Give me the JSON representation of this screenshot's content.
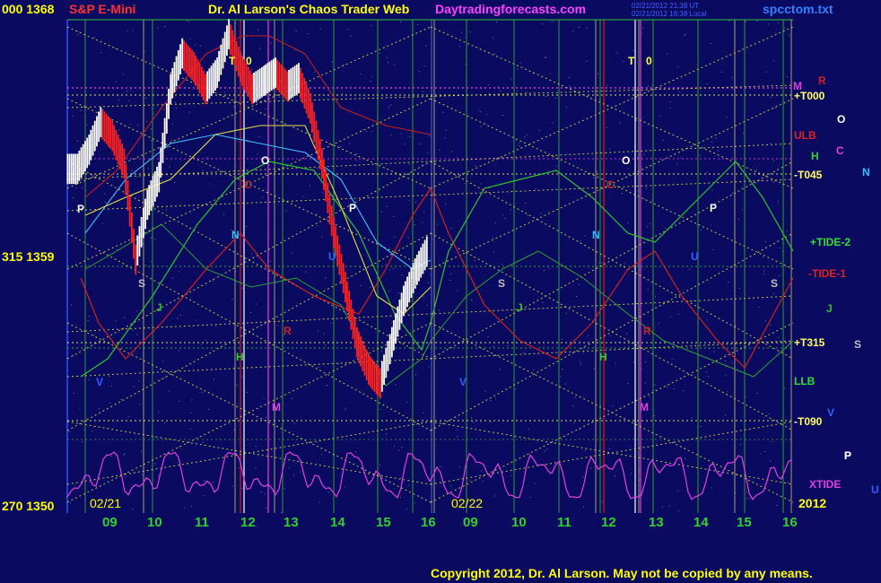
{
  "header": {
    "price_top": "000  1368",
    "instrument": "S&P E-Mini",
    "title": "Dr. Al Larson's Chaos Trader Web",
    "site": "Daytradingforecasts.com",
    "timestamp1": "02/21/2012 21:38 UT",
    "timestamp2": "02/21/2012 16:38 Local",
    "file": "spcctom.txt"
  },
  "left_axis": {
    "mid": "315  1359",
    "bottom": "270  1350"
  },
  "date_labels": [
    "02/21",
    "02/22"
  ],
  "year": "2012",
  "copyright": "Copyright 2012, Dr. Al Larson. May not be copied by any means.",
  "colors": {
    "background": "#0a0a60",
    "grid_green": "#2f9a2f",
    "grid_yellow": "#e8e84a",
    "price_bar_up": "#ffffff",
    "price_bar_down": "#ff2020",
    "xtide": "#e040e0",
    "tide_green": "#30c030",
    "tide_red": "#d02020",
    "cyan_avg": "#40c0ff",
    "yellow_avg": "#e0e040"
  },
  "chart_data": {
    "type": "line",
    "title": "S&P E-Mini",
    "y_axis_left": [
      {
        "value": 1368,
        "label": "000  1368"
      },
      {
        "value": 1359,
        "label": "315  1359"
      },
      {
        "value": 1350,
        "label": "270  1350"
      }
    ],
    "ylim": [
      1350,
      1368
    ],
    "x_tick_labels": [
      "09",
      "10",
      "11",
      "12",
      "13",
      "14",
      "15",
      "16",
      "09",
      "10",
      "11",
      "12",
      "13",
      "14",
      "15",
      "16"
    ],
    "sessions": [
      "02/21",
      "02/22"
    ],
    "price_close_series": {
      "name": "S&P E-Mini",
      "hours": [
        8.5,
        8.75,
        9.0,
        9.25,
        9.5,
        9.75,
        10.0,
        10.25,
        10.5,
        10.75,
        11.0,
        11.25,
        11.5,
        11.75,
        12.0,
        12.25,
        12.5,
        12.75,
        13.0,
        13.25,
        13.5,
        13.75,
        14.0,
        14.25,
        14.5,
        14.75,
        15.0,
        15.25,
        15.5,
        15.75,
        16.0
      ],
      "closes": [
        1362.3,
        1363.0,
        1364.0,
        1363.5,
        1362.5,
        1359.0,
        1361.0,
        1362.0,
        1365.2,
        1366.5,
        1366.0,
        1365.2,
        1365.8,
        1367.2,
        1366.0,
        1365.2,
        1365.5,
        1365.8,
        1365.3,
        1365.6,
        1364.5,
        1362.5,
        1360.0,
        1358.0,
        1356.0,
        1355.0,
        1354.5,
        1356.0,
        1357.5,
        1358.5,
        1359.3
      ]
    },
    "right_labels": [
      {
        "text": "M",
        "color": "#e040e0"
      },
      {
        "text": "R",
        "color": "#d02020"
      },
      {
        "text": "+T000",
        "color": "#ffff60"
      },
      {
        "text": "O",
        "color": "#ffffff"
      },
      {
        "text": "ULB",
        "color": "#e02020"
      },
      {
        "text": "C",
        "color": "#e040e0"
      },
      {
        "text": "H",
        "color": "#30d030"
      },
      {
        "text": "-T045",
        "color": "#ffff60"
      },
      {
        "text": "N",
        "color": "#30c0ff"
      },
      {
        "text": "P",
        "color": "#ffffff"
      },
      {
        "text": "+TIDE-2",
        "color": "#30e030"
      },
      {
        "text": "-TIDE-1",
        "color": "#e02020"
      },
      {
        "text": "J",
        "color": "#30c030"
      },
      {
        "text": "+T315",
        "color": "#ffff60"
      },
      {
        "text": "S",
        "color": "#c0c0c0"
      },
      {
        "text": "LLB",
        "color": "#30e030"
      },
      {
        "text": "V",
        "color": "#3060ff"
      },
      {
        "text": "-T090",
        "color": "#ffff60"
      },
      {
        "text": "P",
        "color": "#ffffff"
      },
      {
        "text": "XTIDE",
        "color": "#e040e0"
      },
      {
        "text": "U",
        "color": "#3060ff"
      }
    ],
    "plot_markers": [
      "T",
      "0",
      "T",
      "0",
      "O",
      "O",
      "C",
      "C",
      "P",
      "P",
      "P",
      "N",
      "N",
      "S",
      "S",
      "S",
      "S",
      "J",
      "J",
      "H",
      "H",
      "M",
      "M",
      "R",
      "R",
      "U",
      "U",
      "V",
      "V"
    ],
    "grid": true,
    "legend": "right"
  }
}
